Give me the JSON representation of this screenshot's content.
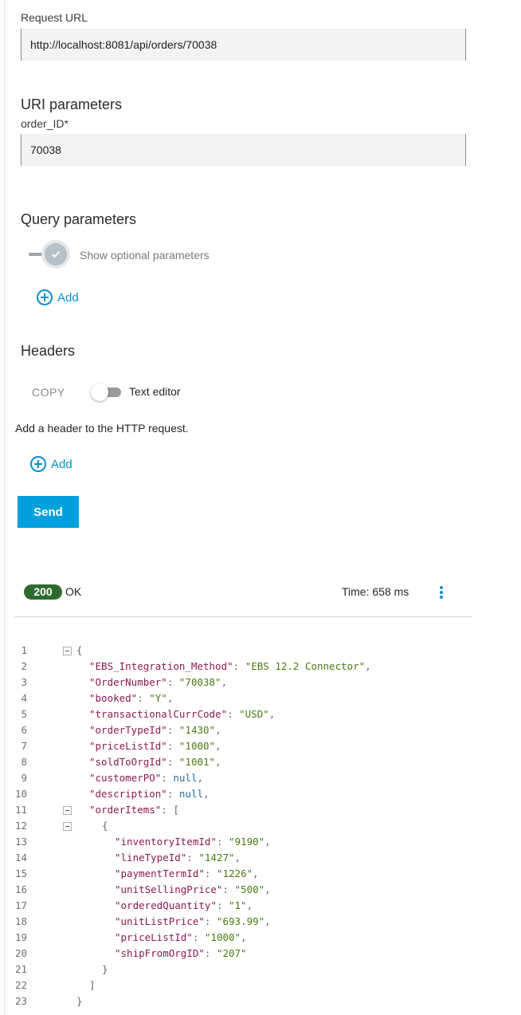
{
  "request_url": {
    "label": "Request URL",
    "value": "http://localhost:8081/api/orders/70038"
  },
  "uri_parameters": {
    "title": "URI parameters",
    "param_label": "order_ID*",
    "param_value": "70038"
  },
  "query_parameters": {
    "title": "Query parameters",
    "toggle_label": "Show optional parameters",
    "toggle_on": true,
    "add_label": "Add"
  },
  "headers": {
    "title": "Headers",
    "copy_label": "COPY",
    "text_editor_label": "Text editor",
    "text_editor_on": false,
    "help_text": "Add a header to the HTTP request.",
    "add_label": "Add"
  },
  "send": {
    "label": "Send"
  },
  "response": {
    "status_code": "200",
    "status_text": "OK",
    "time": "Time: 658 ms",
    "lines": [
      {
        "n": "1",
        "fold": true,
        "indent": 0,
        "parts": [
          {
            "t": "p",
            "v": "{"
          }
        ]
      },
      {
        "n": "2",
        "fold": false,
        "indent": 2,
        "parts": [
          {
            "t": "k",
            "v": "\"EBS_Integration_Method\""
          },
          {
            "t": "p",
            "v": ": "
          },
          {
            "t": "s",
            "v": "\"EBS 12.2 Connector\""
          },
          {
            "t": "p",
            "v": ","
          }
        ]
      },
      {
        "n": "3",
        "fold": false,
        "indent": 2,
        "parts": [
          {
            "t": "k",
            "v": "\"OrderNumber\""
          },
          {
            "t": "p",
            "v": ": "
          },
          {
            "t": "s",
            "v": "\"70038\""
          },
          {
            "t": "p",
            "v": ","
          }
        ]
      },
      {
        "n": "4",
        "fold": false,
        "indent": 2,
        "parts": [
          {
            "t": "k",
            "v": "\"booked\""
          },
          {
            "t": "p",
            "v": ": "
          },
          {
            "t": "s",
            "v": "\"Y\""
          },
          {
            "t": "p",
            "v": ","
          }
        ]
      },
      {
        "n": "5",
        "fold": false,
        "indent": 2,
        "parts": [
          {
            "t": "k",
            "v": "\"transactionalCurrCode\""
          },
          {
            "t": "p",
            "v": ": "
          },
          {
            "t": "s",
            "v": "\"USD\""
          },
          {
            "t": "p",
            "v": ","
          }
        ]
      },
      {
        "n": "6",
        "fold": false,
        "indent": 2,
        "parts": [
          {
            "t": "k",
            "v": "\"orderTypeId\""
          },
          {
            "t": "p",
            "v": ": "
          },
          {
            "t": "s",
            "v": "\"1430\""
          },
          {
            "t": "p",
            "v": ","
          }
        ]
      },
      {
        "n": "7",
        "fold": false,
        "indent": 2,
        "parts": [
          {
            "t": "k",
            "v": "\"priceListId\""
          },
          {
            "t": "p",
            "v": ": "
          },
          {
            "t": "s",
            "v": "\"1000\""
          },
          {
            "t": "p",
            "v": ","
          }
        ]
      },
      {
        "n": "8",
        "fold": false,
        "indent": 2,
        "parts": [
          {
            "t": "k",
            "v": "\"soldToOrgId\""
          },
          {
            "t": "p",
            "v": ": "
          },
          {
            "t": "s",
            "v": "\"1001\""
          },
          {
            "t": "p",
            "v": ","
          }
        ]
      },
      {
        "n": "9",
        "fold": false,
        "indent": 2,
        "parts": [
          {
            "t": "k",
            "v": "\"customerPO\""
          },
          {
            "t": "p",
            "v": ": "
          },
          {
            "t": "n",
            "v": "null"
          },
          {
            "t": "p",
            "v": ","
          }
        ]
      },
      {
        "n": "10",
        "fold": false,
        "indent": 2,
        "parts": [
          {
            "t": "k",
            "v": "\"description\""
          },
          {
            "t": "p",
            "v": ": "
          },
          {
            "t": "n",
            "v": "null"
          },
          {
            "t": "p",
            "v": ","
          }
        ]
      },
      {
        "n": "11",
        "fold": true,
        "indent": 2,
        "parts": [
          {
            "t": "k",
            "v": "\"orderItems\""
          },
          {
            "t": "p",
            "v": ": ["
          }
        ]
      },
      {
        "n": "12",
        "fold": true,
        "indent": 4,
        "parts": [
          {
            "t": "p",
            "v": "{"
          }
        ]
      },
      {
        "n": "13",
        "fold": false,
        "indent": 6,
        "parts": [
          {
            "t": "k",
            "v": "\"inventoryItemId\""
          },
          {
            "t": "p",
            "v": ": "
          },
          {
            "t": "s",
            "v": "\"9190\""
          },
          {
            "t": "p",
            "v": ","
          }
        ]
      },
      {
        "n": "14",
        "fold": false,
        "indent": 6,
        "parts": [
          {
            "t": "k",
            "v": "\"lineTypeId\""
          },
          {
            "t": "p",
            "v": ": "
          },
          {
            "t": "s",
            "v": "\"1427\""
          },
          {
            "t": "p",
            "v": ","
          }
        ]
      },
      {
        "n": "15",
        "fold": false,
        "indent": 6,
        "parts": [
          {
            "t": "k",
            "v": "\"paymentTermId\""
          },
          {
            "t": "p",
            "v": ": "
          },
          {
            "t": "s",
            "v": "\"1226\""
          },
          {
            "t": "p",
            "v": ","
          }
        ]
      },
      {
        "n": "16",
        "fold": false,
        "indent": 6,
        "parts": [
          {
            "t": "k",
            "v": "\"unitSellingPrice\""
          },
          {
            "t": "p",
            "v": ": "
          },
          {
            "t": "s",
            "v": "\"500\""
          },
          {
            "t": "p",
            "v": ","
          }
        ]
      },
      {
        "n": "17",
        "fold": false,
        "indent": 6,
        "parts": [
          {
            "t": "k",
            "v": "\"orderedQuantity\""
          },
          {
            "t": "p",
            "v": ": "
          },
          {
            "t": "s",
            "v": "\"1\""
          },
          {
            "t": "p",
            "v": ","
          }
        ]
      },
      {
        "n": "18",
        "fold": false,
        "indent": 6,
        "parts": [
          {
            "t": "k",
            "v": "\"unitListPrice\""
          },
          {
            "t": "p",
            "v": ": "
          },
          {
            "t": "s",
            "v": "\"693.99\""
          },
          {
            "t": "p",
            "v": ","
          }
        ]
      },
      {
        "n": "19",
        "fold": false,
        "indent": 6,
        "parts": [
          {
            "t": "k",
            "v": "\"priceListId\""
          },
          {
            "t": "p",
            "v": ": "
          },
          {
            "t": "s",
            "v": "\"1000\""
          },
          {
            "t": "p",
            "v": ","
          }
        ]
      },
      {
        "n": "20",
        "fold": false,
        "indent": 6,
        "parts": [
          {
            "t": "k",
            "v": "\"shipFromOrgID\""
          },
          {
            "t": "p",
            "v": ": "
          },
          {
            "t": "s",
            "v": "\"207\""
          }
        ]
      },
      {
        "n": "21",
        "fold": false,
        "indent": 4,
        "parts": [
          {
            "t": "p",
            "v": "}"
          }
        ]
      },
      {
        "n": "22",
        "fold": false,
        "indent": 2,
        "parts": [
          {
            "t": "p",
            "v": "]"
          }
        ]
      },
      {
        "n": "23",
        "fold": false,
        "indent": 0,
        "parts": [
          {
            "t": "p",
            "v": "}"
          }
        ]
      }
    ]
  },
  "colors": {
    "accent": "#00a0df",
    "link": "#0b8fcc",
    "status_ok": "#2e6b2f",
    "json_key": "#8b1a56",
    "json_string": "#4a7a12",
    "json_null": "#1f6fa6"
  },
  "icons": {
    "optional_toggle": "check-icon",
    "add": "plus-circle-icon",
    "menu": "kebab-menu-icon"
  }
}
